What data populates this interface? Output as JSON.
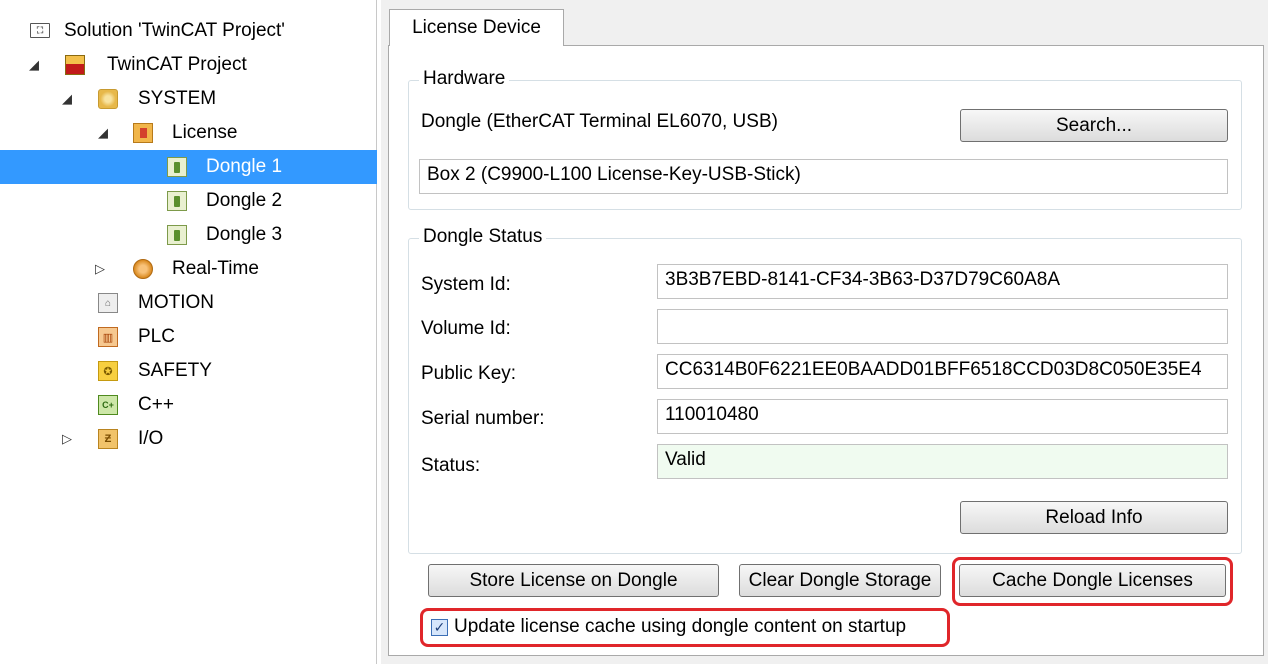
{
  "tree": {
    "solution": "Solution 'TwinCAT Project'",
    "project": "TwinCAT Project",
    "system": "SYSTEM",
    "license": "License",
    "dongle1": "Dongle 1",
    "dongle2": "Dongle 2",
    "dongle3": "Dongle 3",
    "realtime": "Real-Time",
    "motion": "MOTION",
    "plc": "PLC",
    "safety": "SAFETY",
    "cpp": "C++",
    "io": "I/O"
  },
  "tab": {
    "label": "License Device"
  },
  "hardware": {
    "group_title": "Hardware",
    "device_label": "Dongle (EtherCAT Terminal EL6070, USB)",
    "search_button": "Search...",
    "box_value": "Box 2 (C9900-L100 License-Key-USB-Stick)"
  },
  "status": {
    "group_title": "Dongle Status",
    "system_id_label": "System Id:",
    "system_id_value": "3B3B7EBD-8141-CF34-3B63-D37D79C60A8A",
    "volume_id_label": "Volume Id:",
    "volume_id_value": "",
    "public_key_label": "Public Key:",
    "public_key_value": "CC6314B0F6221EE0BAADD01BFF6518CCD03D8C050E35E4",
    "serial_label": "Serial number:",
    "serial_value": "110010480",
    "status_label": "Status:",
    "status_value": "Valid",
    "reload_button": "Reload Info"
  },
  "actions": {
    "store_button": "Store License on Dongle",
    "clear_button": "Clear Dongle Storage",
    "cache_button": "Cache Dongle Licenses",
    "checkbox_label": "Update license cache using dongle content on startup",
    "checkbox_checked": true
  },
  "colors": {
    "selection": "#3399ff",
    "highlight": "#e0262a",
    "valid_bg": "#f0fbf0"
  }
}
